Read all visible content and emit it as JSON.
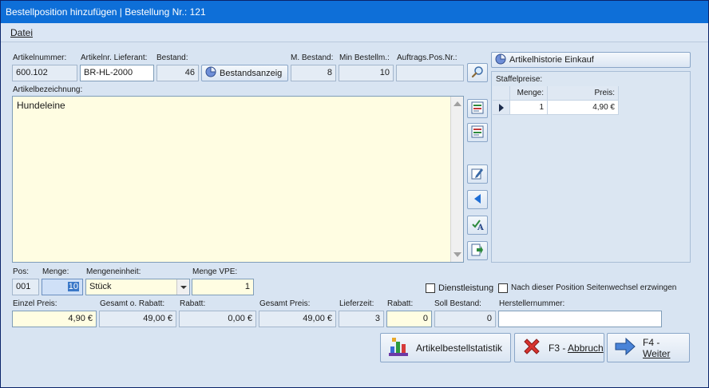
{
  "window": {
    "title": "Bestellposition hinzufügen  |  Bestellung Nr.: 121"
  },
  "menu": {
    "datei": "Datei"
  },
  "header": {
    "artikelnummer_label": "Artikelnummer:",
    "artikelnummer": "600.102",
    "artikelnr_lieferant_label": "Artikelnr. Lieferant:",
    "artikelnr_lieferant": "BR-HL-2000",
    "bestand_label": "Bestand:",
    "bestand": "46",
    "bestandsanzeige_button": "Bestandsanzeig",
    "m_bestand_label": "M. Bestand:",
    "m_bestand": "8",
    "min_bestellm_label": "Min Bestellm.:",
    "min_bestellm": "10",
    "auftrags_pos_label": "Auftrags.Pos.Nr.:",
    "auftrags_pos": ""
  },
  "artikelbezeichnung": {
    "label": "Artikelbezeichnung:",
    "text": "Hundeleine"
  },
  "right": {
    "historie_button": "Artikelhistorie Einkauf",
    "staffelpreise_label": "Staffelpreise:",
    "grid_headers": [
      "Menge:",
      "Preis:"
    ],
    "rows": [
      {
        "menge": "1",
        "preis": "4,90 €"
      }
    ]
  },
  "position": {
    "pos_label": "Pos:",
    "pos": "001",
    "menge_label": "Menge:",
    "menge": "10",
    "mengeneinheit_label": "Mengeneinheit:",
    "mengeneinheit": "Stück",
    "menge_vpe_label": "Menge VPE:",
    "menge_vpe": "1",
    "dienstleistung_label": "Dienstleistung",
    "seitenwechsel_label": "Nach dieser Position Seitenwechsel erzwingen"
  },
  "prices": {
    "einzel_preis_label": "Einzel Preis:",
    "einzel_preis": "4,90 €",
    "gesamt_o_rabatt_label": "Gesamt o. Rabatt:",
    "gesamt_o_rabatt": "49,00 €",
    "rabatt_betrag_label": "Rabatt:",
    "rabatt_betrag": "0,00 €",
    "gesamt_preis_label": "Gesamt Preis:",
    "gesamt_preis": "49,00 €",
    "lieferzeit_label": "Lieferzeit:",
    "lieferzeit": "3",
    "rabatt_label": "Rabatt:",
    "rabatt": "0",
    "soll_bestand_label": "Soll Bestand:",
    "soll_bestand": "0",
    "herstellernummer_label": "Herstellernummer:",
    "herstellernummer": ""
  },
  "footer": {
    "statistik_button": "Artikelbestellstatistik",
    "abbruch_prefix": "F3 - ",
    "abbruch_label": "Abbruch",
    "weiter_prefix": "F4 - ",
    "weiter_label": "Weiter"
  }
}
